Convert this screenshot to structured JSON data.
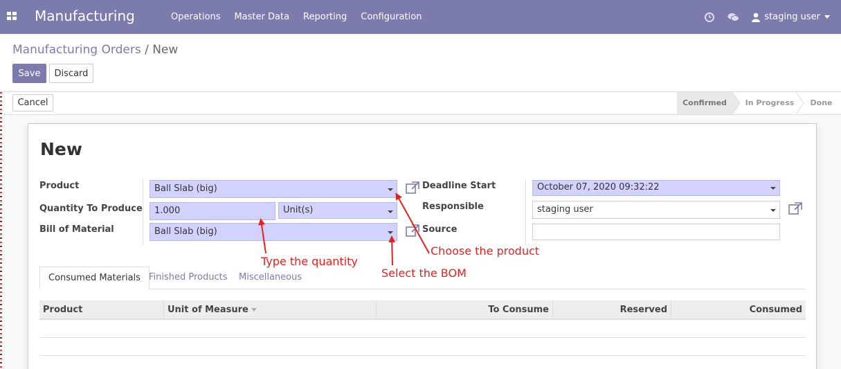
{
  "navbar": {
    "app_title": "Manufacturing",
    "menu": [
      "Operations",
      "Master Data",
      "Reporting",
      "Configuration"
    ],
    "user": "staging user",
    "icons": [
      "apps-grid-icon",
      "clock-icon",
      "chat-icon",
      "user-icon"
    ]
  },
  "breadcrumb": {
    "parent": "Manufacturing Orders",
    "separator": "/",
    "current": "New"
  },
  "buttons": {
    "save": "Save",
    "discard": "Discard",
    "cancel": "Cancel"
  },
  "status": {
    "stages": [
      "Confirmed",
      "In Progress",
      "Done"
    ],
    "active": "Confirmed"
  },
  "form": {
    "title": "New",
    "product_label": "Product",
    "product_value": "Ball Slab (big)",
    "qty_label": "Quantity To Produce",
    "qty_value": "1.000",
    "uom_value": "Unit(s)",
    "bom_label": "Bill of Material",
    "bom_value": "Ball Slab (big)",
    "deadline_label": "Deadline Start",
    "deadline_value": "October 07, 2020 09:32:22",
    "responsible_label": "Responsible",
    "responsible_value": "staging user",
    "source_label": "Source",
    "source_value": ""
  },
  "tabs": [
    "Consumed Materials",
    "Finished Products",
    "Miscellaneous"
  ],
  "table": {
    "columns": [
      "Product",
      "Unit of Measure",
      "To Consume",
      "Reserved",
      "Consumed"
    ]
  },
  "annotations": {
    "choose_product": "Choose the product",
    "type_quantity": "Type the quantity",
    "select_bom": "Select the BOM"
  },
  "colors": {
    "brand": "#7c7bad",
    "required_field": "#d2d2ff",
    "annotation": "#e8201d"
  }
}
